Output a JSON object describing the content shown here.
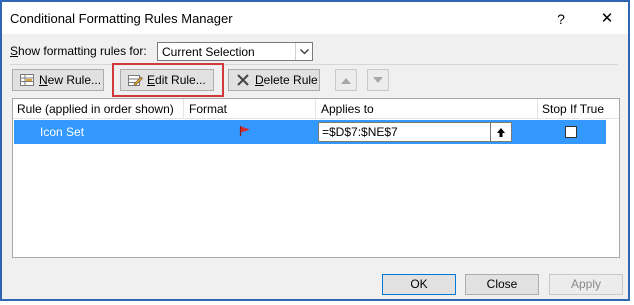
{
  "window": {
    "title": "Conditional Formatting Rules Manager",
    "help_glyph": "?",
    "close_glyph": "✕"
  },
  "filter": {
    "label_prefix": "S",
    "label_rest": "how formatting rules for:",
    "selected": "Current Selection"
  },
  "toolbar": {
    "new_rule_u": "N",
    "new_rule_rest": "ew Rule...",
    "edit_rule_u": "E",
    "edit_rule_rest": "dit Rule...",
    "delete_rule_u": "D",
    "delete_rule_rest": "elete Rule",
    "move_up_icon": "up-arrow-icon",
    "move_down_icon": "down-arrow-icon"
  },
  "table": {
    "headers": {
      "rule": "Rule (applied in order shown)",
      "format": "Format",
      "applies_to": "Applies to",
      "stop_if_true": "Stop If True"
    },
    "rows": [
      {
        "rule": "Icon Set",
        "format_icon": "red-flag-icon",
        "applies_to": "=$D$7:$NE$7",
        "stop_if_true": false,
        "selected": true
      }
    ]
  },
  "footer": {
    "ok": "OK",
    "close": "Close",
    "apply": "Apply"
  },
  "colors": {
    "selection": "#3399ff",
    "highlight_border": "#d03a3a",
    "window_border": "#2f66b3"
  }
}
